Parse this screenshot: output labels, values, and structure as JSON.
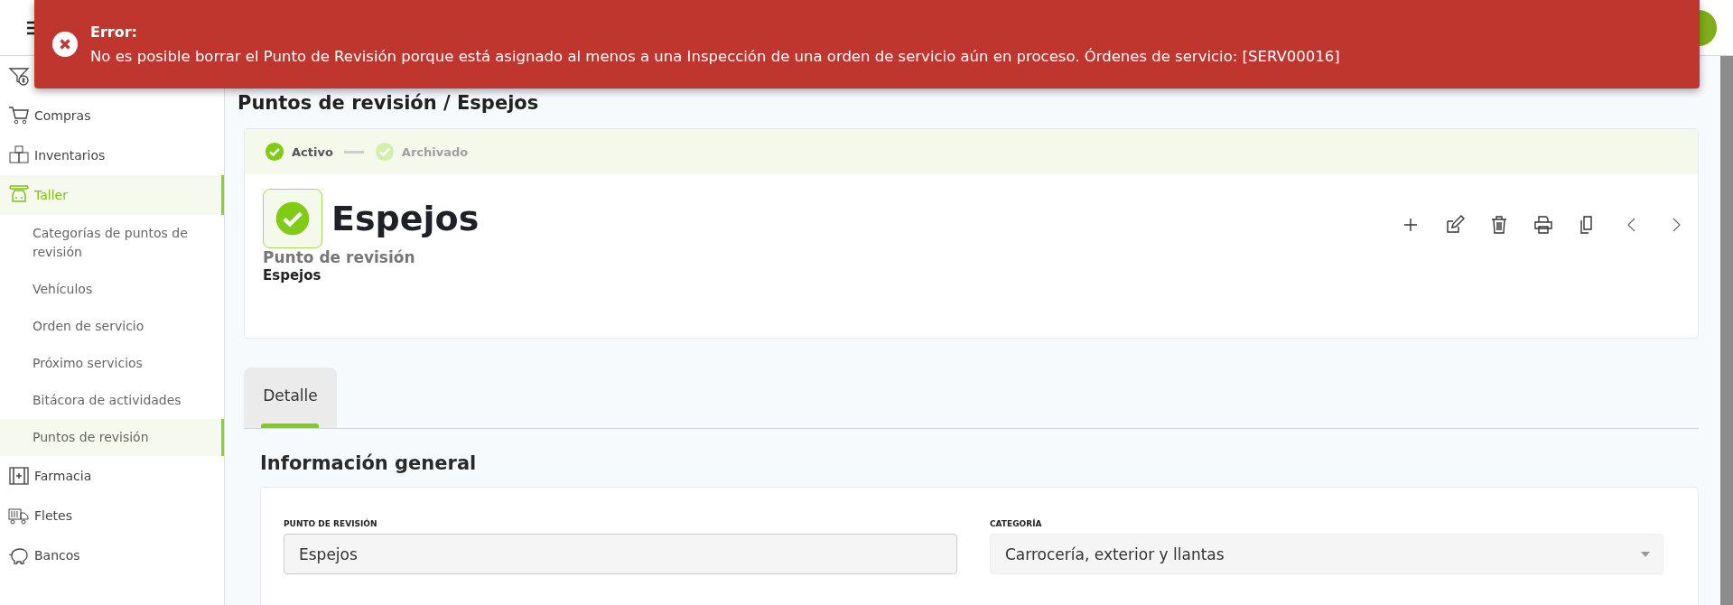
{
  "toast": {
    "title": "Error:",
    "message": "No es posible borrar el Punto de Revisión porque está asignado al menos a una Inspección de una orden de servicio aún en proceso. Órdenes de servicio: [SERV00016]"
  },
  "sidebar": {
    "items": [
      {
        "selected": false
      },
      {
        "label": "Compras",
        "selected": false
      },
      {
        "label": "Inventarios",
        "selected": false
      },
      {
        "label": "Taller",
        "selected": true,
        "children": [
          {
            "label": "Categorías de puntos de revisión",
            "selected": false
          },
          {
            "label": "Vehículos",
            "selected": false
          },
          {
            "label": "Orden de servicio",
            "selected": false
          },
          {
            "label": "Próximo servicios",
            "selected": false
          },
          {
            "label": "Bitácora de actividades",
            "selected": false
          },
          {
            "label": "Puntos de revisión",
            "selected": true
          }
        ]
      },
      {
        "label": "Farmacia",
        "selected": false
      },
      {
        "label": "Fletes",
        "selected": false
      },
      {
        "label": "Bancos",
        "selected": false
      }
    ]
  },
  "breadcrumb": "Puntos de revisión /  Espejos",
  "status_steps": [
    {
      "label": "Activo",
      "selected": true
    },
    {
      "label": "Archivado",
      "selected": false
    }
  ],
  "record": {
    "title": "Espejos",
    "subtitle": "Punto de revisión",
    "value": "Espejos"
  },
  "tabs": [
    {
      "label": "Detalle",
      "selected": true
    }
  ],
  "section_title": "Información general",
  "fields": [
    {
      "label": "PUNTO DE REVISIÓN",
      "value": "Espejos",
      "kind": "text"
    },
    {
      "label": "CATEGORÍA",
      "value": "Carrocería, exterior y llantas",
      "kind": "select"
    }
  ]
}
